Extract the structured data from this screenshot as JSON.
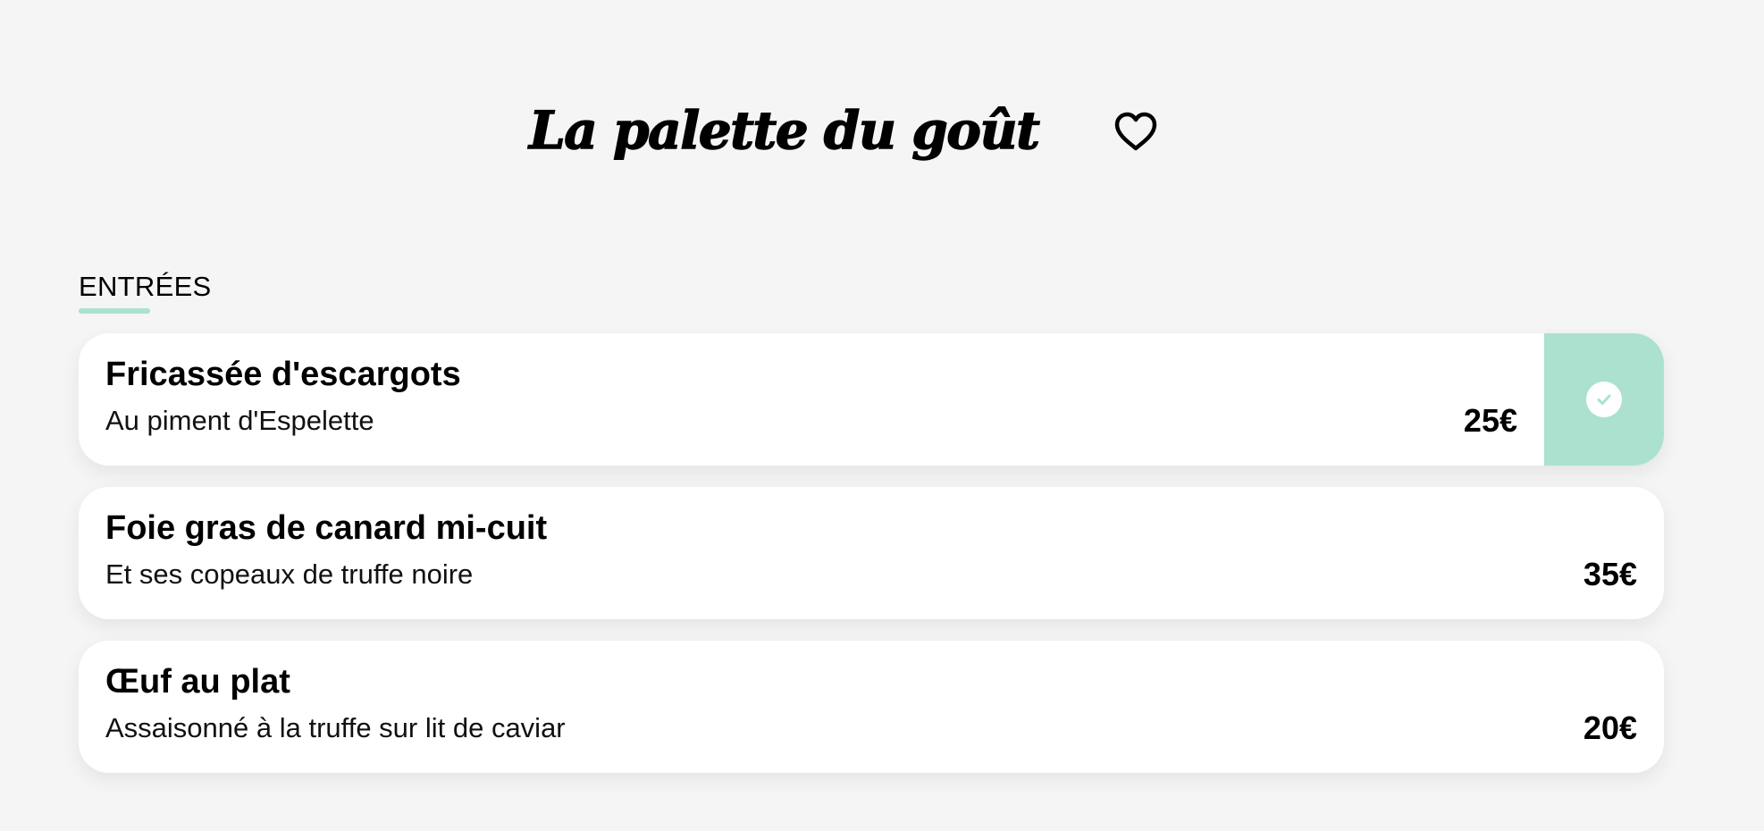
{
  "header": {
    "title": "La palette du goût",
    "favorite_icon": "heart-outline-icon"
  },
  "section": {
    "title": "ENTRÉES"
  },
  "items": [
    {
      "name": "Fricassée d'escargots",
      "description": "Au piment d'Espelette",
      "price": "25€",
      "selected": true
    },
    {
      "name": "Foie gras de canard mi-cuit",
      "description": "Et ses copeaux de truffe noire",
      "price": "35€",
      "selected": false
    },
    {
      "name": "Œuf au plat",
      "description": "Assaisonné à la truffe sur lit de caviar",
      "price": "20€",
      "selected": false
    }
  ],
  "selected_icon": "check-circle-icon",
  "colors": {
    "accent": "#ace1d0",
    "background": "#f5f5f5",
    "card": "#ffffff",
    "text": "#000000"
  }
}
